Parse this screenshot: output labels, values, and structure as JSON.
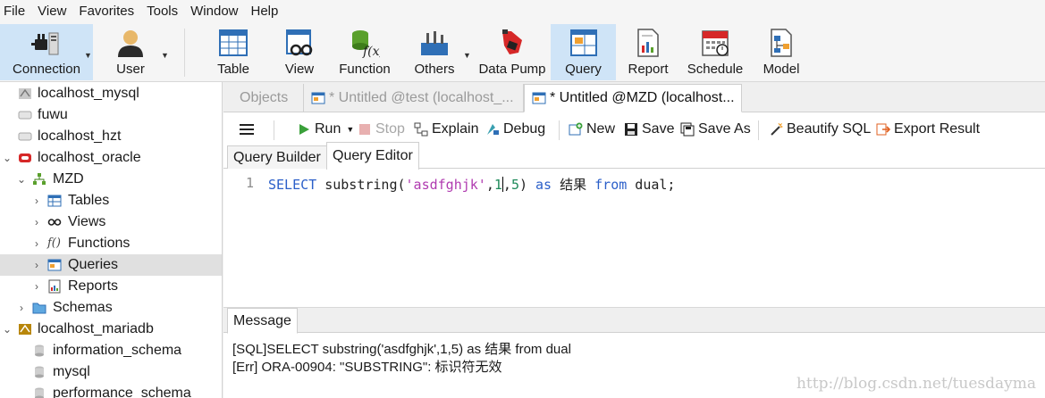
{
  "menu": [
    "File",
    "View",
    "Favorites",
    "Tools",
    "Window",
    "Help"
  ],
  "ribbon": {
    "connection": "Connection",
    "user": "User",
    "table": "Table",
    "view": "View",
    "function": "Function",
    "others": "Others",
    "data_pump": "Data Pump",
    "query": "Query",
    "report": "Report",
    "schedule": "Schedule",
    "model": "Model"
  },
  "tree": [
    {
      "label": "localhost_mysql"
    },
    {
      "label": "fuwu"
    },
    {
      "label": "localhost_hzt"
    },
    {
      "label": "localhost_oracle"
    },
    {
      "label": "MZD"
    },
    {
      "label": "Tables"
    },
    {
      "label": "Views"
    },
    {
      "label": "Functions"
    },
    {
      "label": "Queries"
    },
    {
      "label": "Reports"
    },
    {
      "label": "Schemas"
    },
    {
      "label": "localhost_mariadb"
    },
    {
      "label": "information_schema"
    },
    {
      "label": "mysql"
    },
    {
      "label": "performance_schema"
    }
  ],
  "tabs": {
    "objects": "Objects",
    "untitled_test": "* Untitled @test (localhost_...",
    "untitled_mzd": "* Untitled @MZD (localhost..."
  },
  "query_toolbar": {
    "run": "Run",
    "stop": "Stop",
    "explain": "Explain",
    "debug": "Debug",
    "new": "New",
    "save": "Save",
    "save_as": "Save As",
    "beautify": "Beautify SQL",
    "export": "Export Result"
  },
  "subtabs": {
    "builder": "Query Builder",
    "editor": "Query Editor"
  },
  "editor": {
    "line_number": "1",
    "kw_select": "SELECT",
    "fn": " substring(",
    "str": "'asdfghjk'",
    "comma1": ",",
    "num1": "1",
    "comma2": ",",
    "num2": "5",
    "paren": ") ",
    "kw_as": "as",
    "alias": " 结果 ",
    "kw_from": "from",
    "tail": " dual;"
  },
  "message": {
    "tab": "Message",
    "line1": "[SQL]SELECT substring('asdfghjk',1,5) as 结果 from dual",
    "line2": "[Err] ORA-00904: \"SUBSTRING\": 标识符无效"
  },
  "watermark": "http://blog.csdn.net/tuesdayma"
}
